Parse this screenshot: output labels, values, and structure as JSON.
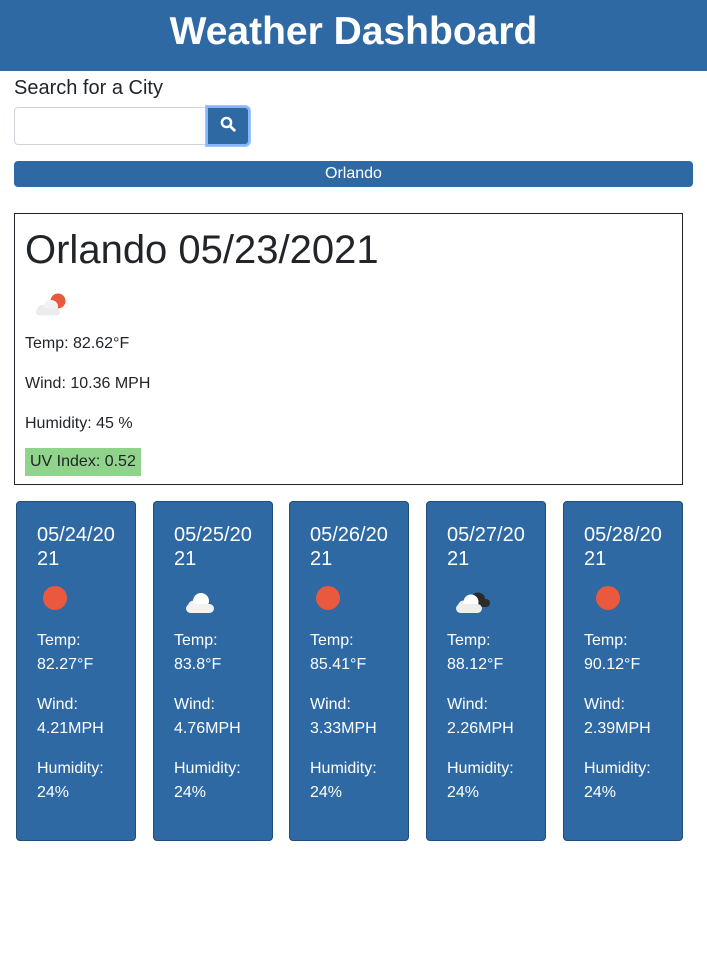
{
  "header": {
    "title": "Weather Dashboard"
  },
  "search": {
    "label": "Search for a City",
    "value": "",
    "placeholder": "",
    "button_icon": "search-icon"
  },
  "history": [
    "Orlando"
  ],
  "current": {
    "city_date": "Orlando 05/23/2021",
    "icon": "sun-behind-cloud-icon",
    "temp": "Temp: 82.62°F",
    "wind": "Wind: 10.36 MPH",
    "humidity": "Humidity: 45 %",
    "uv": "UV Index: 0.52",
    "uv_color": "#90d38a"
  },
  "forecast": [
    {
      "date": "05/24/2021",
      "icon": "sun-icon",
      "temp_label": "Temp:",
      "temp": "82.27°F",
      "wind_label": "Wind:",
      "wind": "4.21MPH",
      "humidity_label": "Humidity:",
      "humidity": "24%"
    },
    {
      "date": "05/25/2021",
      "icon": "cloud-icon",
      "temp_label": "Temp:",
      "temp": "83.8°F",
      "wind_label": "Wind:",
      "wind": "4.76MPH",
      "humidity_label": "Humidity:",
      "humidity": "24%"
    },
    {
      "date": "05/26/2021",
      "icon": "sun-icon",
      "temp_label": "Temp:",
      "temp": "85.41°F",
      "wind_label": "Wind:",
      "wind": "3.33MPH",
      "humidity_label": "Humidity:",
      "humidity": "24%"
    },
    {
      "date": "05/27/2021",
      "icon": "broken-clouds-icon",
      "temp_label": "Temp:",
      "temp": "88.12°F",
      "wind_label": "Wind:",
      "wind": "2.26MPH",
      "humidity_label": "Humidity:",
      "humidity": "24%"
    },
    {
      "date": "05/28/2021",
      "icon": "sun-icon",
      "temp_label": "Temp:",
      "temp": "90.12°F",
      "wind_label": "Wind:",
      "wind": "2.39MPH",
      "humidity_label": "Humidity:",
      "humidity": "24%"
    }
  ],
  "colors": {
    "brand": "#2f69a3",
    "sun": "#e8593d",
    "uv_low": "#90d38a"
  }
}
